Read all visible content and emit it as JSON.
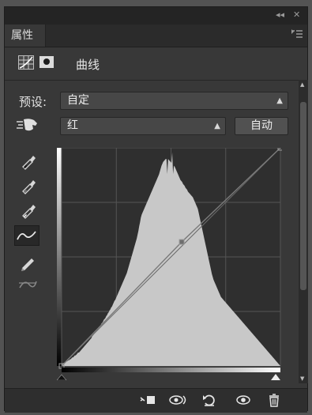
{
  "window": {
    "collapse_label": "◂◂",
    "close_label": "✕"
  },
  "tabs": [
    {
      "label": "属性"
    }
  ],
  "header": {
    "title": "曲线",
    "adjustment_icon": "curves-adjustment-icon",
    "mask_icon": "layer-mask-icon"
  },
  "preset": {
    "label": "预设:",
    "value": "自定"
  },
  "channel": {
    "value": "红",
    "auto_label": "自动"
  },
  "tools": [
    "target-adjust-hand-icon",
    "sample-black-eyedropper-icon",
    "sample-gray-eyedropper-icon",
    "sample-white-eyedropper-icon",
    "curve-edit-points-icon",
    "pencil-draw-icon",
    "smooth-curve-icon"
  ],
  "curve": {
    "points": [
      [
        0,
        0
      ],
      [
        140,
        145
      ],
      [
        255,
        255
      ]
    ],
    "histogram": [
      2,
      2,
      3,
      3,
      4,
      4,
      5,
      5,
      6,
      6,
      7,
      7,
      8,
      9,
      9,
      10,
      11,
      11,
      12,
      13,
      14,
      14,
      15,
      16,
      17,
      18,
      19,
      20,
      21,
      22,
      23,
      24,
      25,
      26,
      27,
      28,
      29,
      31,
      32,
      33,
      34,
      35,
      36,
      37,
      38,
      40,
      41,
      42,
      44,
      45,
      46,
      48,
      49,
      50,
      52,
      53,
      55,
      56,
      58,
      59,
      61,
      62,
      64,
      66,
      68,
      69,
      71,
      73,
      75,
      77,
      79,
      81,
      83,
      85,
      87,
      89,
      91,
      93,
      95,
      97,
      100,
      103,
      106,
      109,
      112,
      115,
      118,
      121,
      124,
      127,
      130,
      133,
      137,
      141,
      146,
      150,
      155,
      158,
      160,
      162,
      164,
      166,
      168,
      170,
      172,
      174,
      176,
      178,
      180,
      182,
      184,
      186,
      188,
      190,
      192,
      194,
      196,
      198,
      200,
      203,
      206,
      209,
      211,
      213,
      214,
      215,
      216,
      216,
      217,
      216,
      215,
      214,
      213,
      212,
      211,
      210,
      209,
      208,
      206,
      204,
      202,
      200,
      198,
      196,
      194,
      193,
      192,
      190,
      189,
      188,
      186,
      185,
      184,
      182,
      181,
      180,
      179,
      178,
      177,
      176,
      174,
      172,
      170,
      168,
      166,
      164,
      160,
      156,
      152,
      148,
      144,
      140,
      136,
      132,
      128,
      124,
      120,
      116,
      112,
      108,
      104,
      100,
      96,
      93,
      90,
      88,
      86,
      84,
      82,
      80,
      78,
      76,
      74,
      72,
      71,
      70,
      69,
      68,
      67,
      66,
      65,
      64,
      63,
      62,
      61,
      60,
      59,
      58,
      57,
      56,
      55,
      54,
      53,
      52,
      51,
      50,
      49,
      48,
      47,
      46,
      45,
      44,
      43,
      42,
      41,
      40,
      39,
      38,
      37,
      36,
      35,
      34,
      33,
      32,
      31,
      30,
      29,
      28,
      27,
      26,
      25,
      24,
      23,
      22,
      21,
      20,
      19,
      18,
      17,
      16,
      15,
      14,
      13,
      12,
      11,
      10,
      9,
      8,
      7,
      6,
      5,
      4,
      3,
      2,
      1,
      0
    ]
  },
  "footer": {
    "icons": [
      "clip-to-layer-icon",
      "view-previous-state-icon",
      "reset-icon",
      "visibility-eye-icon",
      "delete-trash-icon"
    ]
  },
  "colors": {
    "panel_bg": "#383838",
    "graph_bg": "#2f2f2f",
    "histogram_fill": "#c8c8c8",
    "grid": "#5a5a5a"
  }
}
